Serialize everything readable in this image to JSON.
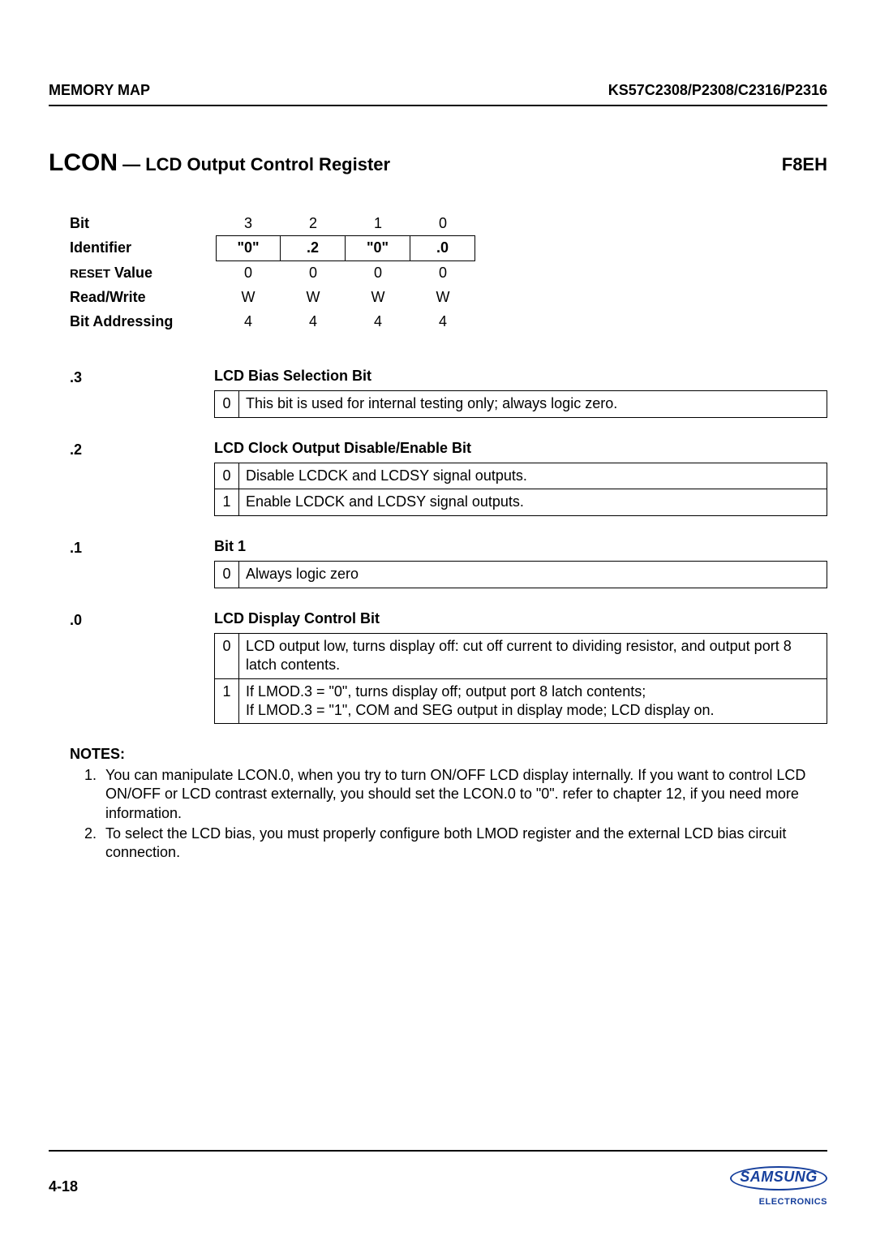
{
  "header": {
    "left": "MEMORY MAP",
    "right": "KS57C2308/P2308/C2316/P2316"
  },
  "title": {
    "reg": "LCON",
    "desc": " — LCD Output Control Register",
    "addr": "F8EH"
  },
  "bit_table": {
    "bit": {
      "label": "Bit",
      "cells": [
        "3",
        "2",
        "1",
        "0"
      ]
    },
    "identifier": {
      "label": "Identifier",
      "cells": [
        "\"0\"",
        ".2",
        "\"0\"",
        ".0"
      ]
    },
    "reset": {
      "label_prefix": "RESET",
      "label_suffix": " Value",
      "cells": [
        "0",
        "0",
        "0",
        "0"
      ]
    },
    "rw": {
      "label": "Read/Write",
      "cells": [
        "W",
        "W",
        "W",
        "W"
      ]
    },
    "addr": {
      "label": "Bit Addressing",
      "cells": [
        "4",
        "4",
        "4",
        "4"
      ]
    }
  },
  "sections": [
    {
      "tag": ".3",
      "title": "LCD Bias Selection Bit",
      "rows": [
        {
          "v": "0",
          "t": "This bit is used for internal testing only; always logic zero."
        }
      ]
    },
    {
      "tag": ".2",
      "title": "LCD Clock Output Disable/Enable Bit",
      "rows": [
        {
          "v": "0",
          "t": "Disable LCDCK and LCDSY signal outputs."
        },
        {
          "v": "1",
          "t": "Enable LCDCK and LCDSY signal outputs."
        }
      ]
    },
    {
      "tag": ".1",
      "title": "Bit 1",
      "rows": [
        {
          "v": "0",
          "t": "Always logic zero"
        }
      ]
    },
    {
      "tag": ".0",
      "title": "LCD Display Control Bit",
      "rows": [
        {
          "v": "0",
          "t": "LCD output low, turns display off: cut off current to dividing resistor, and output port 8 latch contents."
        },
        {
          "v": "1",
          "t": "If LMOD.3 = \"0\", turns display off; output port 8 latch contents;\nIf LMOD.3 = \"1\", COM and SEG output in display mode; LCD display on."
        }
      ]
    }
  ],
  "notes": {
    "heading": "NOTES:",
    "items": [
      "You can manipulate LCON.0, when you try to turn ON/OFF LCD display internally. If you want to control LCD ON/OFF or LCD contrast externally, you should set the LCON.0 to \"0\". refer to chapter 12, if you need more information.",
      "To select the LCD bias, you must properly configure both LMOD register and the external LCD bias circuit connection."
    ]
  },
  "footer": {
    "page": "4-18",
    "logo_main": "SAMSUNG",
    "logo_sub": "ELECTRONICS"
  }
}
